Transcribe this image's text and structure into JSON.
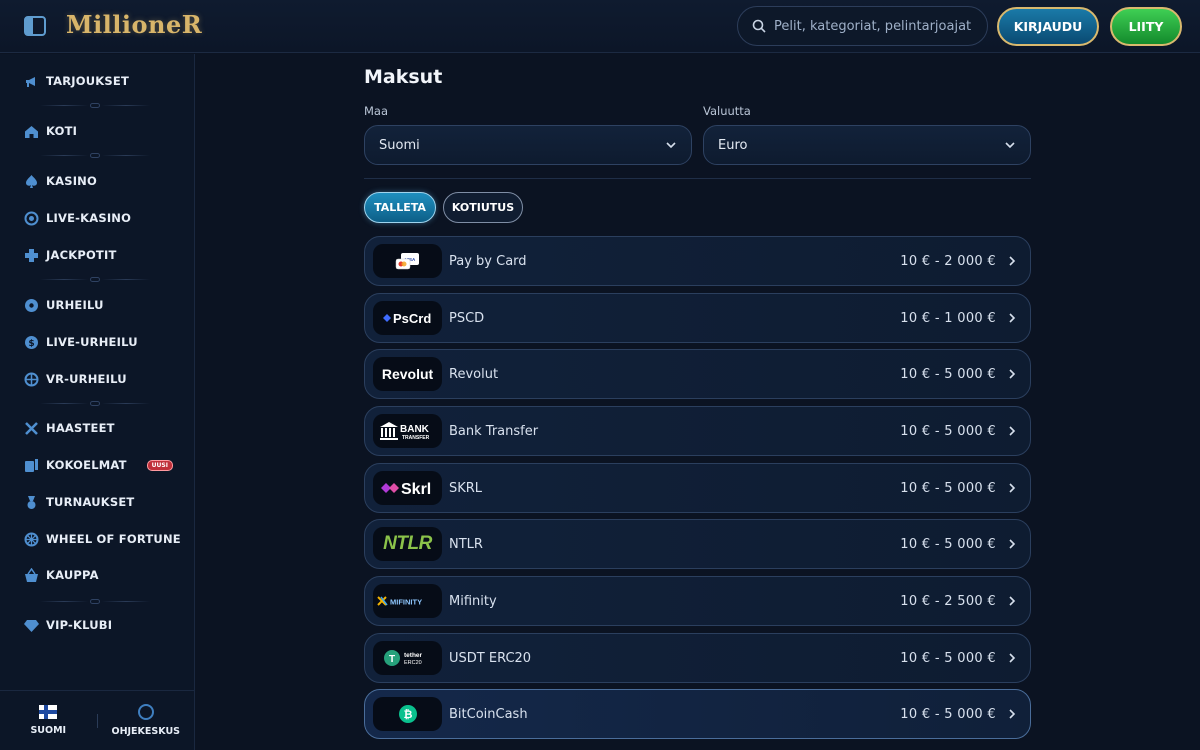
{
  "header": {
    "logo": "MillioneR",
    "search_placeholder": "Pelit, kategoriat, pelintarjoajat",
    "login_label": "KIRJAUDU",
    "join_label": "LIITY"
  },
  "sidebar": {
    "items": [
      {
        "label": "TARJOUKSET",
        "icon": "megaphone-icon"
      },
      {
        "label": "KOTI",
        "icon": "home-icon"
      },
      {
        "label": "KASINO",
        "icon": "spade-icon"
      },
      {
        "label": "LIVE-KASINO",
        "icon": "live-casino-icon"
      },
      {
        "label": "JACKPOTIT",
        "icon": "jackpot-icon"
      },
      {
        "label": "URHEILU",
        "icon": "football-icon"
      },
      {
        "label": "LIVE-URHEILU",
        "icon": "live-sport-icon"
      },
      {
        "label": "VR-URHEILU",
        "icon": "vr-sport-icon"
      },
      {
        "label": "HAASTEET",
        "icon": "swords-icon"
      },
      {
        "label": "KOKOELMAT",
        "icon": "collections-icon",
        "badge": "UUSI"
      },
      {
        "label": "TURNAUKSET",
        "icon": "medal-icon"
      },
      {
        "label": "WHEEL OF FORTUNE",
        "icon": "wheel-icon"
      },
      {
        "label": "KAUPPA",
        "icon": "basket-icon"
      },
      {
        "label": "VIP-KLUBI",
        "icon": "diamond-icon"
      }
    ],
    "footer": {
      "language_label": "SUOMI",
      "help_label": "OHJEKESKUS"
    }
  },
  "main": {
    "title": "Maksut",
    "country_label": "Maa",
    "country_value": "Suomi",
    "currency_label": "Valuutta",
    "currency_value": "Euro",
    "tabs": [
      {
        "label": "TALLETA",
        "active": true
      },
      {
        "label": "KOTIUTUS",
        "active": false
      }
    ],
    "methods": [
      {
        "name": "Pay by Card",
        "range": "10 € - 2 000 €",
        "logo": "card-logo"
      },
      {
        "name": "PSCD",
        "range": "10 € - 1 000 €",
        "logo": "PsCrd"
      },
      {
        "name": "Revolut",
        "range": "10 € - 5 000 €",
        "logo": "Revolut"
      },
      {
        "name": "Bank Transfer",
        "range": "10 € - 5 000 €",
        "logo": "BANK TRANSFER"
      },
      {
        "name": "SKRL",
        "range": "10 € - 5 000 €",
        "logo": "Skrl"
      },
      {
        "name": "NTLR",
        "range": "10 € - 5 000 €",
        "logo": "NTLR"
      },
      {
        "name": "Mifinity",
        "range": "10 € - 2 500 €",
        "logo": "MIFINITY"
      },
      {
        "name": "USDT ERC20",
        "range": "10 € - 5 000 €",
        "logo": "tether ERC20"
      },
      {
        "name": "BitCoinCash",
        "range": "10 € - 5 000 €",
        "logo": "bitcoin-cash-logo"
      }
    ]
  },
  "colors": {
    "background": "#0b1322",
    "accent_gold": "#d9b96e",
    "login_blue": "#1a7aa8",
    "join_green": "#3fcf54"
  }
}
